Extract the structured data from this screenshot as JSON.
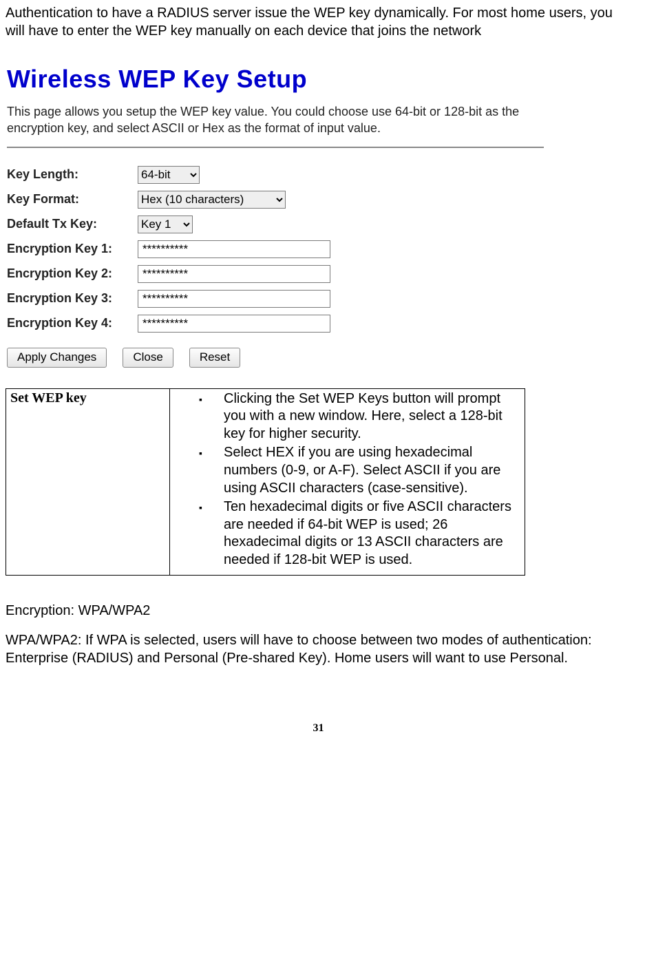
{
  "intro": "Authentication to have a RADIUS server issue the WEP key dynamically. For most home users, you will have to enter the WEP key manually on each device that joins the network",
  "wep": {
    "title": "Wireless WEP Key Setup",
    "desc": "This page allows you setup the WEP key value. You could choose use 64-bit or 128-bit as the encryption key, and select ASCII or Hex as the format of input value.",
    "labels": {
      "keyLength": "Key Length:",
      "keyFormat": "Key Format:",
      "defaultTx": "Default Tx Key:",
      "key1": "Encryption Key 1:",
      "key2": "Encryption Key 2:",
      "key3": "Encryption Key 3:",
      "key4": "Encryption Key 4:"
    },
    "values": {
      "keyLength": "64-bit",
      "keyFormat": "Hex (10 characters)",
      "defaultTx": "Key 1",
      "key1": "**********",
      "key2": "**********",
      "key3": "**********",
      "key4": "**********"
    },
    "buttons": {
      "apply": "Apply Changes",
      "close": "Close",
      "reset": "Reset"
    }
  },
  "table": {
    "left": "Set WEP key",
    "bullets": {
      "b1": "Clicking the Set WEP Keys button will prompt you with a new window. Here, select a 128-bit key for higher security.",
      "b2": "Select HEX if you are using hexadecimal numbers (0-9, or A-F). Select ASCII if you are using ASCII characters (case-sensitive).",
      "b3": "Ten hexadecimal digits or five ASCII characters   are needed if 64-bit WEP is used; 26 hexadecimal digits or 13 ASCII characters are needed if 128-bit WEP is used."
    }
  },
  "sectionHeading": "Encryption: WPA/WPA2",
  "wpaPara": "WPA/WPA2: If WPA is selected, users will have to choose between two modes of authentication: Enterprise (RADIUS) and Personal (Pre-shared Key). Home users will want to use Personal.",
  "pageNumber": "31"
}
